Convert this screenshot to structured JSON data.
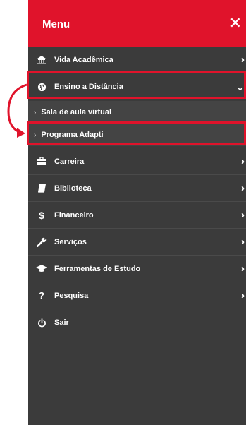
{
  "menu": {
    "title": "Menu",
    "close_symbol": "✕",
    "items": [
      {
        "label": "Vida Acadêmica",
        "icon": "building-icon"
      },
      {
        "label": "Ensino a Distância",
        "icon": "globe-icon"
      },
      {
        "label": "Carreira",
        "icon": "briefcase-icon"
      },
      {
        "label": "Biblioteca",
        "icon": "book-icon"
      },
      {
        "label": "Financeiro",
        "icon": "dollar-icon"
      },
      {
        "label": "Serviços",
        "icon": "wrench-icon"
      },
      {
        "label": "Ferramentas de Estudo",
        "icon": "graduation-cap-icon"
      },
      {
        "label": "Pesquisa",
        "icon": "question-icon"
      },
      {
        "label": "Sair",
        "icon": "power-icon"
      }
    ],
    "subitems": [
      {
        "label": "Sala de aula virtual"
      },
      {
        "label": "Programa Adapti"
      }
    ],
    "expanded_item": "Ensino a Distância"
  },
  "colors": {
    "accent": "#e0132b",
    "panel_bg": "#3b3b3b",
    "submenu_bg": "#444444",
    "text": "#ffffff"
  }
}
